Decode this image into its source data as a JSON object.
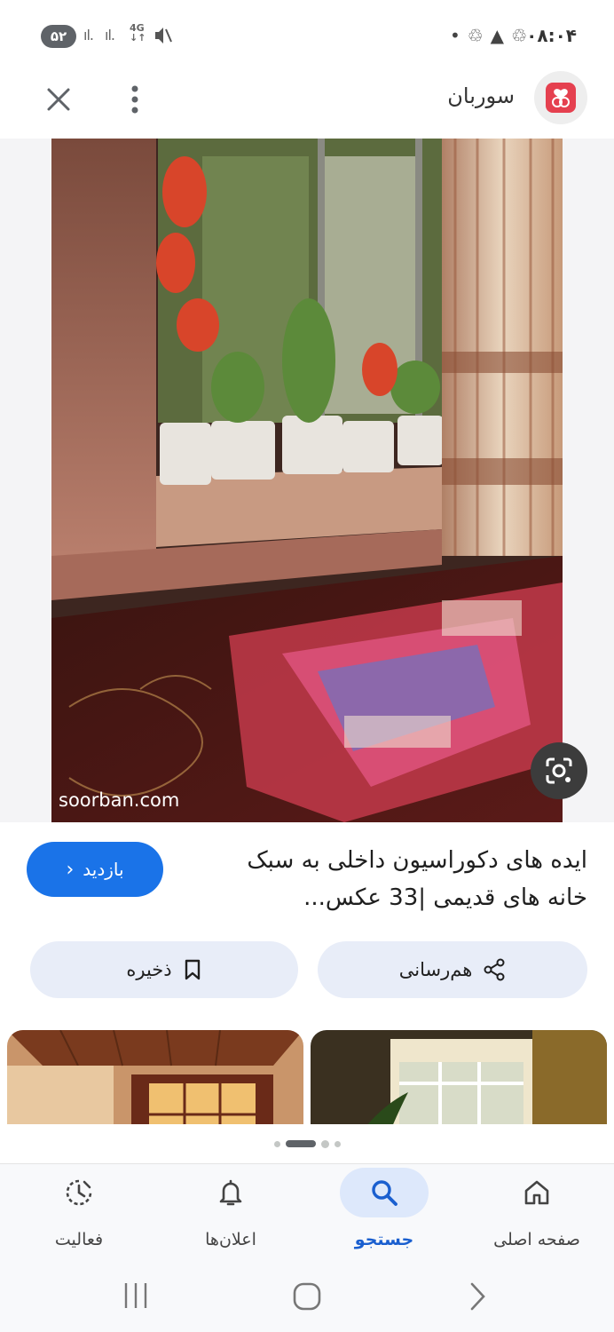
{
  "status_bar": {
    "battery": "۵۲",
    "network": "4G",
    "time": "۰۸:۰۴"
  },
  "header": {
    "site_name": "سوربان",
    "icons": [
      "close-icon",
      "more-vert-icon",
      "site-logo-icon"
    ]
  },
  "image": {
    "watermark": "soorban.com",
    "lens_icon": "google-lens-icon"
  },
  "result": {
    "title": "ایده های دکوراسیون داخلی به سبک خانه های قدیمی |33 عکس...",
    "visit_label": "بازدید"
  },
  "actions": {
    "share_label": "هم‌رسانی",
    "save_label": "ذخیره"
  },
  "bottom_nav": {
    "items": [
      {
        "label": "صفحه اصلی",
        "icon": "home-icon"
      },
      {
        "label": "جستجو",
        "icon": "search-icon",
        "active": true
      },
      {
        "label": "اعلان‌ها",
        "icon": "bell-icon"
      },
      {
        "label": "فعالیت",
        "icon": "activity-icon"
      }
    ]
  },
  "colors": {
    "accent": "#1a73e8",
    "pill_bg": "#e8edf8",
    "nav_active_bg": "#dde8fb"
  }
}
